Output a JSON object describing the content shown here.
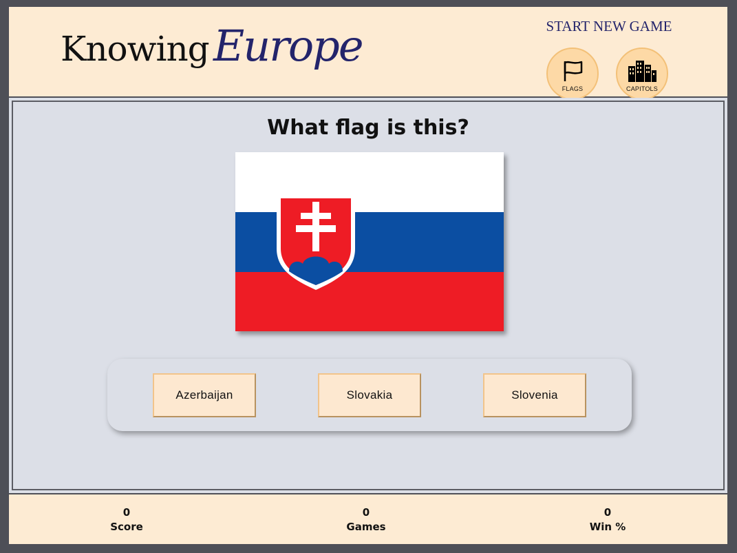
{
  "header": {
    "logo_part1": "Knowing",
    "logo_part2": "Europe",
    "new_game_label": "START NEW GAME",
    "modes": [
      {
        "label": "FLAGS",
        "icon": "flag-icon"
      },
      {
        "label": "CAPITOLS",
        "icon": "city-icon"
      }
    ]
  },
  "quiz": {
    "question": "What flag is this?",
    "flag_icon": "slovakia-flag",
    "answers": [
      "Azerbaijan",
      "Slovakia",
      "Slovenia"
    ]
  },
  "stats": [
    {
      "value": "0",
      "label": "Score"
    },
    {
      "value": "0",
      "label": "Games"
    },
    {
      "value": "0",
      "label": "Win %"
    }
  ],
  "colors": {
    "background": "#4e4f57",
    "panel": "#fdebd3",
    "main": "#dcdfe7",
    "brand": "#23246b",
    "button": "#fdd9a6"
  }
}
